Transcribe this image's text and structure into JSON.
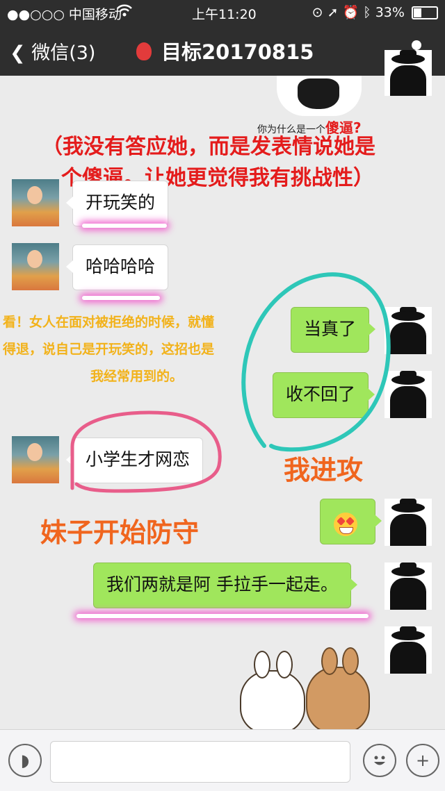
{
  "status_bar": {
    "carrier": "●●○○○ 中国移动",
    "time": "上午11:20",
    "battery": "33%"
  },
  "nav": {
    "back_label": "微信(3)",
    "title": "目标20170815"
  },
  "sticker_caption": {
    "prefix": "你为什么是一个",
    "highlight": "傻逼?"
  },
  "annotations": {
    "red_line1": "（我没有答应她，而是发表情说她是",
    "red_line2": "个傻逼。让她更觉得我有挑战性）",
    "yellow_line1": "看！女人在面对被拒绝的时候，就懂",
    "yellow_line2": "得退，说自己是开玩笑的，这招也是",
    "yellow_line3": "我经常用到的。",
    "i_attack": "我进攻",
    "girl_defends": "妹子开始防守"
  },
  "messages": [
    {
      "side": "left",
      "text": "开玩笑的"
    },
    {
      "side": "left",
      "text": "哈哈哈哈"
    },
    {
      "side": "right",
      "text": "当真了"
    },
    {
      "side": "right",
      "text": "收不回了"
    },
    {
      "side": "left",
      "text": "小学生才网恋"
    },
    {
      "side": "right",
      "text": ""
    },
    {
      "side": "right",
      "text": "我们两就是阿 手拉手一起走。"
    }
  ],
  "colors": {
    "bar": "#2e2e2e",
    "chat_bg": "#ebebeb",
    "bubble_green": "#a0e65c",
    "annotation_red": "#e41c1c",
    "annotation_yellow": "#f2b21a",
    "annotation_orange": "#f0651e",
    "circle_teal": "#2ec7b8",
    "circle_pink": "#e85d8a"
  },
  "icons": [
    "signal-icon",
    "wifi-icon",
    "lock-rotation-icon",
    "location-icon",
    "alarm-icon",
    "bluetooth-icon",
    "battery-icon",
    "back-chevron-icon",
    "balloon-icon",
    "person-icon",
    "voice-icon",
    "emoji-face-icon",
    "plus-icon"
  ]
}
